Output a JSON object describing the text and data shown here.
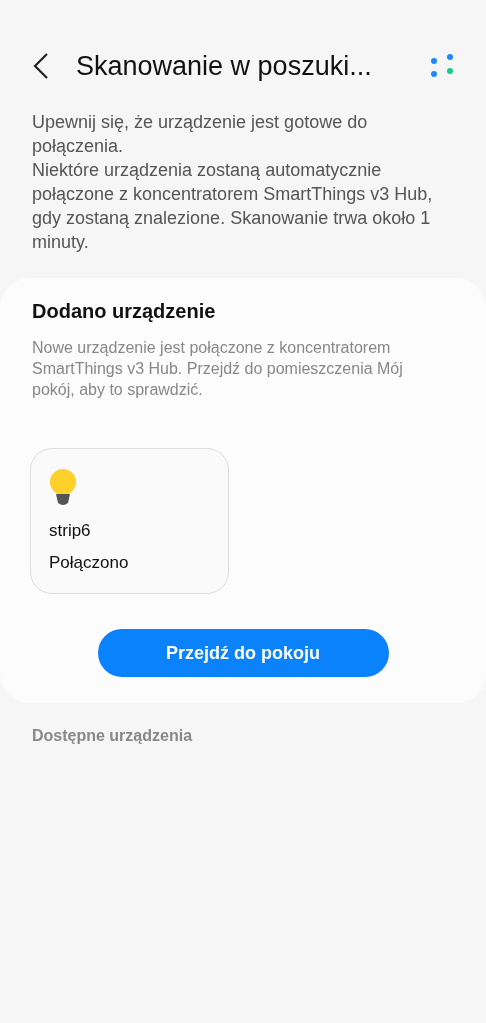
{
  "header": {
    "title": "Skanowanie w poszuki..."
  },
  "intro": [
    "Upewnij się, że urządzenie jest gotowe do połączenia.",
    "Niektóre urządzenia zostaną automatycznie połączone z koncentratorem SmartThings v3 Hub, gdy zostaną znalezione. Skanowanie trwa około 1 minuty."
  ],
  "added_card": {
    "title": "Dodano urządzenie",
    "description": "Nowe urządzenie jest połączone z koncentratorem SmartThings v3 Hub. Przejdź do pomieszczenia Mój pokój, aby to sprawdzić.",
    "devices": [
      {
        "name": "strip6",
        "status": "Połączono",
        "kind": "bulb"
      }
    ],
    "button": "Przejdź do pokoju"
  },
  "available_section": {
    "title": "Dostępne urządzenia"
  }
}
